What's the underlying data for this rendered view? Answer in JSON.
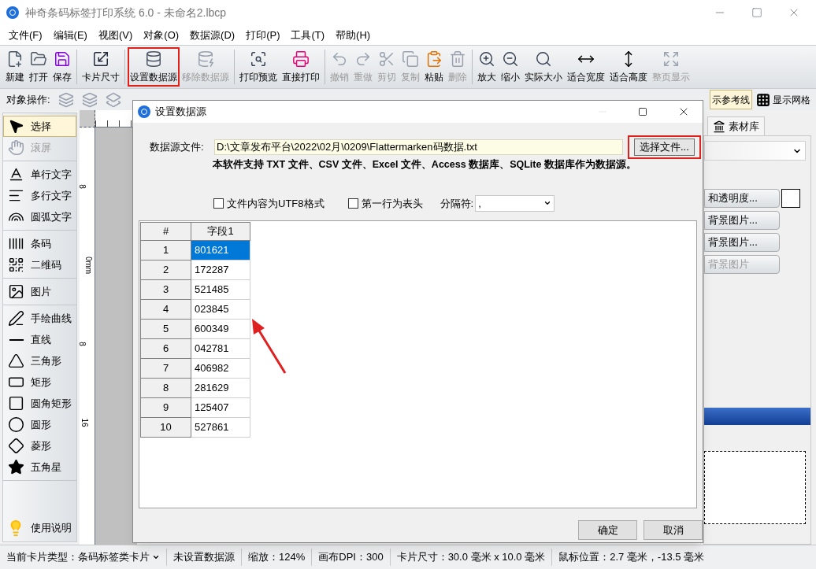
{
  "window": {
    "title": "神奇条码标签打印系统 6.0 - 未命名2.lbcp"
  },
  "menu": [
    "文件(F)",
    "编辑(E)",
    "视图(V)",
    "对象(O)",
    "数据源(D)",
    "打印(P)",
    "工具(T)",
    "帮助(H)"
  ],
  "toolbar": {
    "groups": [
      [
        {
          "label": "新建",
          "disabled": false,
          "highlighted": false
        },
        {
          "label": "打开",
          "disabled": false,
          "highlighted": false
        },
        {
          "label": "保存",
          "disabled": false,
          "highlighted": false
        }
      ],
      [
        {
          "label": "卡片尺寸",
          "disabled": false,
          "highlighted": false
        }
      ],
      [
        {
          "label": "设置数据源",
          "disabled": false,
          "highlighted": true
        },
        {
          "label": "移除数据源",
          "disabled": true,
          "highlighted": false
        }
      ],
      [
        {
          "label": "打印预览",
          "disabled": false,
          "highlighted": false
        },
        {
          "label": "直接打印",
          "disabled": false,
          "highlighted": false
        }
      ],
      [
        {
          "label": "撤销",
          "disabled": true,
          "highlighted": false
        },
        {
          "label": "重做",
          "disabled": true,
          "highlighted": false
        },
        {
          "label": "剪切",
          "disabled": true,
          "highlighted": false
        },
        {
          "label": "复制",
          "disabled": true,
          "highlighted": false
        },
        {
          "label": "粘贴",
          "disabled": false,
          "highlighted": false
        },
        {
          "label": "删除",
          "disabled": true,
          "highlighted": false
        }
      ],
      [
        {
          "label": "放大",
          "disabled": false,
          "highlighted": false
        },
        {
          "label": "缩小",
          "disabled": false,
          "highlighted": false
        },
        {
          "label": "实际大小",
          "disabled": false,
          "highlighted": false
        },
        {
          "label": "适合宽度",
          "disabled": false,
          "highlighted": false
        },
        {
          "label": "适合高度",
          "disabled": false,
          "highlighted": false
        },
        {
          "label": "整页显示",
          "disabled": true,
          "highlighted": false
        }
      ]
    ]
  },
  "object_toolbar": {
    "label": "对象操作:",
    "toggles": [
      {
        "label": "示参考线",
        "selected": true
      },
      {
        "label": "显示网格",
        "selected": false
      }
    ]
  },
  "sidebar": {
    "groups": [
      [
        {
          "label": "选择",
          "selected": true,
          "disabled": false
        },
        {
          "label": "滚屏",
          "selected": false,
          "disabled": true
        }
      ],
      [
        {
          "label": "单行文字",
          "selected": false,
          "disabled": false
        },
        {
          "label": "多行文字",
          "selected": false,
          "disabled": false
        },
        {
          "label": "圆弧文字",
          "selected": false,
          "disabled": false
        }
      ],
      [
        {
          "label": "条码",
          "selected": false,
          "disabled": false
        },
        {
          "label": "二维码",
          "selected": false,
          "disabled": false
        }
      ],
      [
        {
          "label": "图片",
          "selected": false,
          "disabled": false
        }
      ],
      [
        {
          "label": "手绘曲线",
          "selected": false,
          "disabled": false
        },
        {
          "label": "直线",
          "selected": false,
          "disabled": false
        },
        {
          "label": "三角形",
          "selected": false,
          "disabled": false
        },
        {
          "label": "矩形",
          "selected": false,
          "disabled": false
        },
        {
          "label": "圆角矩形",
          "selected": false,
          "disabled": false
        },
        {
          "label": "圆形",
          "selected": false,
          "disabled": false
        },
        {
          "label": "菱形",
          "selected": false,
          "disabled": false
        },
        {
          "label": "五角星",
          "selected": false,
          "disabled": false
        }
      ]
    ],
    "help": "使用说明"
  },
  "ruler": {
    "labels": [
      "8",
      "0mm",
      "8",
      "16"
    ]
  },
  "right_panel": {
    "tab": "素材库",
    "buttons": [
      {
        "label": "和透明度...",
        "disabled": false
      },
      {
        "label": "背景图片...",
        "disabled": false
      },
      {
        "label": "背景图片...",
        "disabled": false
      },
      {
        "label": "背景图片",
        "disabled": true
      }
    ]
  },
  "dialog": {
    "title": "设置数据源",
    "file_label": "数据源文件:",
    "file_path": "D:\\文章发布平台\\2022\\02月\\0209\\Flattermarken码数据.txt",
    "choose_button": {
      "label": "选择文件...",
      "highlighted": true
    },
    "note": "本软件支持 TXT 文件、CSV 文件、Excel 文件、Access 数据库、SQLite 数据库作为数据源。",
    "options": [
      {
        "label": "文件内容为UTF8格式",
        "checked": false
      },
      {
        "label": "第一行为表头",
        "checked": false
      }
    ],
    "separator": {
      "label": "分隔符:",
      "value": ","
    },
    "table": {
      "columns": [
        "#",
        "字段1"
      ],
      "rows": [
        {
          "cells": [
            "1",
            "801621"
          ],
          "selected": true
        },
        {
          "cells": [
            "2",
            "172287"
          ],
          "selected": false
        },
        {
          "cells": [
            "3",
            "521485"
          ],
          "selected": false
        },
        {
          "cells": [
            "4",
            "023845"
          ],
          "selected": false
        },
        {
          "cells": [
            "5",
            "600349"
          ],
          "selected": false
        },
        {
          "cells": [
            "6",
            "042781"
          ],
          "selected": false
        },
        {
          "cells": [
            "7",
            "406982"
          ],
          "selected": false
        },
        {
          "cells": [
            "8",
            "281629"
          ],
          "selected": false
        },
        {
          "cells": [
            "9",
            "125407"
          ],
          "selected": false
        },
        {
          "cells": [
            "10",
            "527861"
          ],
          "selected": false
        }
      ]
    },
    "buttons": [
      "确定",
      "取消"
    ]
  },
  "status_bar": [
    {
      "text": "当前卡片类型：条码标签类卡片",
      "kind": "dropdown"
    },
    {
      "text": "未设置数据源",
      "kind": "text"
    },
    {
      "text": "缩放：124%",
      "kind": "text"
    },
    {
      "text": "画布DPI：300",
      "kind": "text"
    },
    {
      "text": "卡片尺寸：30.0 毫米 x 10.0 毫米",
      "kind": "text"
    },
    {
      "text": "鼠标位置：2.7 毫米，-13.5 毫米",
      "kind": "text"
    }
  ]
}
